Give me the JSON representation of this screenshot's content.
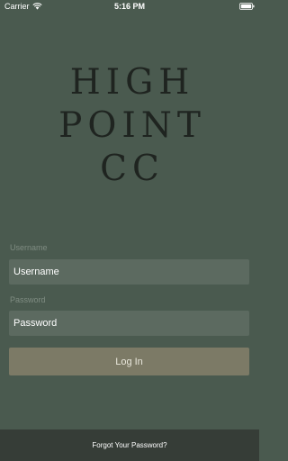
{
  "status_bar": {
    "carrier": "Carrier",
    "time": "5:16 PM",
    "icons": [
      "wifi-icon",
      "battery-icon"
    ]
  },
  "logo": {
    "lines": [
      "HIGH",
      "POINT",
      "CC"
    ]
  },
  "form": {
    "username_label": "Username",
    "username_placeholder": "Username",
    "password_label": "Password",
    "password_placeholder": "Password",
    "login_label": "Log In"
  },
  "footer": {
    "forgot_label": "Forgot Your Password?"
  },
  "colors": {
    "background": "#4a5a4f",
    "field": "#5c6a60",
    "button": "#7c7a66",
    "footer": "#363d37",
    "logo_text": "#1f2420"
  }
}
